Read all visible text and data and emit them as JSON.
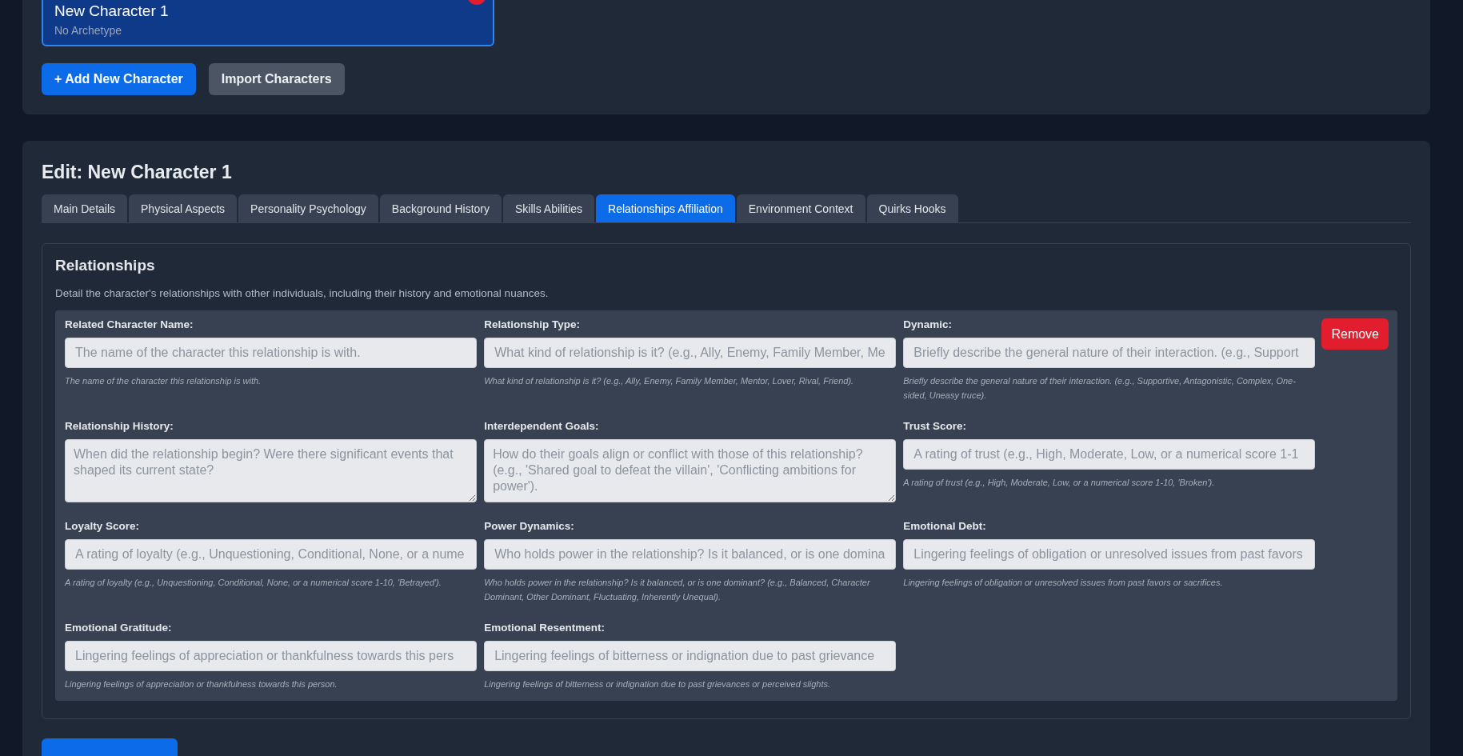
{
  "character_card": {
    "name": "New Character 1",
    "archetype": "No Archetype",
    "selected": true
  },
  "actions": [
    {
      "label": "+ Add New Character",
      "kind": "primary"
    },
    {
      "label": "Import Characters",
      "kind": "secondary"
    }
  ],
  "editor": {
    "title": "Edit: New Character 1",
    "tabs": [
      {
        "label": "Main Details",
        "selected": false
      },
      {
        "label": "Physical Aspects",
        "selected": false
      },
      {
        "label": "Personality Psychology",
        "selected": false
      },
      {
        "label": "Background History",
        "selected": false
      },
      {
        "label": "Skills Abilities",
        "selected": false
      },
      {
        "label": "Relationships Affiliation",
        "selected": true
      },
      {
        "label": "Environment Context",
        "selected": false
      },
      {
        "label": "Quirks Hooks",
        "selected": false
      }
    ],
    "section": {
      "title": "Relationships",
      "description": "Detail the character's relationships with other individuals, including their history and emotional nuances.",
      "relationships": [
        {
          "remove_label": "Remove",
          "fields": [
            {
              "kind": "input",
              "label": "Related Character Name:",
              "placeholder": "The name of the character this relationship is with.",
              "help": "The name of the character this relationship is with."
            },
            {
              "kind": "input",
              "label": "Relationship Type:",
              "placeholder": "What kind of relationship is it? (e.g., Ally, Enemy, Family Member, Me",
              "help": "What kind of relationship is it? (e.g., Ally, Enemy, Family Member, Mentor, Lover, Rival, Friend)."
            },
            {
              "kind": "input",
              "label": "Dynamic:",
              "placeholder": "Briefly describe the general nature of their interaction. (e.g., Support",
              "help": "Briefly describe the general nature of their interaction. (e.g., Supportive, Antagonistic, Complex, One-sided, Uneasy truce)."
            },
            {
              "kind": "textarea",
              "label": "Relationship History:",
              "placeholder": "When did the relationship begin? Were there significant events that shaped its current state?"
            },
            {
              "kind": "textarea",
              "label": "Interdependent Goals:",
              "placeholder": "How do their goals align or conflict with those of this relationship? (e.g., 'Shared goal to defeat the villain', 'Conflicting ambitions for power')."
            },
            {
              "kind": "input",
              "label": "Trust Score:",
              "placeholder": "A rating of trust (e.g., High, Moderate, Low, or a numerical score 1-1",
              "help": "A rating of trust (e.g., High, Moderate, Low, or a numerical score 1-10, 'Broken')."
            },
            {
              "kind": "input",
              "label": "Loyalty Score:",
              "placeholder": "A rating of loyalty (e.g., Unquestioning, Conditional, None, or a nume",
              "help": "A rating of loyalty (e.g., Unquestioning, Conditional, None, or a numerical score 1-10, 'Betrayed')."
            },
            {
              "kind": "input",
              "label": "Power Dynamics:",
              "placeholder": "Who holds power in the relationship? Is it balanced, or is one domina",
              "help": "Who holds power in the relationship? Is it balanced, or is one dominant? (e.g., Balanced, Character Dominant, Other Dominant, Fluctuating, Inherently Unequal)."
            },
            {
              "kind": "input",
              "label": "Emotional Debt:",
              "placeholder": "Lingering feelings of obligation or unresolved issues from past favors",
              "help": "Lingering feelings of obligation or unresolved issues from past favors or sacrifices."
            },
            {
              "kind": "input",
              "label": "Emotional Gratitude:",
              "placeholder": "Lingering feelings of appreciation or thankfulness towards this pers",
              "help": "Lingering feelings of appreciation or thankfulness towards this person."
            },
            {
              "kind": "input",
              "label": "Emotional Resentment:",
              "placeholder": "Lingering feelings of bitterness or indignation due to past grievance",
              "help": "Lingering feelings of bitterness or indignation due to past grievances or perceived slights."
            }
          ]
        }
      ]
    }
  }
}
